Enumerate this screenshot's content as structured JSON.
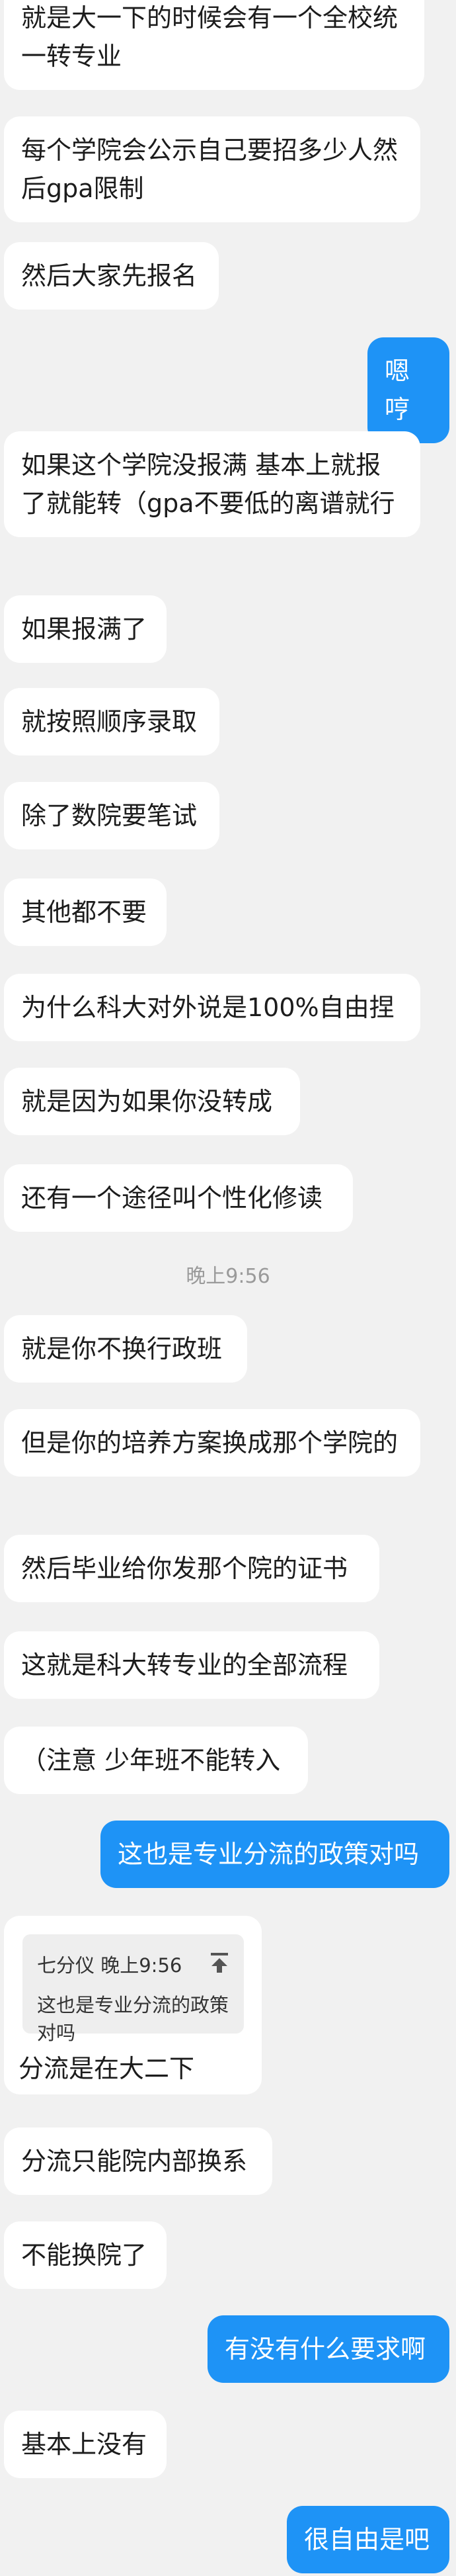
{
  "messages": [
    {
      "text": "就是大一下的时候会有一个全校统一转专业"
    },
    {
      "text": "每个学院会公示自己要招多少人然后gpa限制"
    },
    {
      "text": "然后大家先报名"
    },
    {
      "text": "嗯哼"
    },
    {
      "text": "如果这个学院没报满 基本上就报了就能转（gpa不要低的离谱就行"
    },
    {
      "text": "如果报满了"
    },
    {
      "text": "就按照顺序录取"
    },
    {
      "text": "除了数院要笔试"
    },
    {
      "text": "其他都不要"
    },
    {
      "text": "为什么科大对外说是100%自由捏"
    },
    {
      "text": "就是因为如果你没转成"
    },
    {
      "text": "还有一个途径叫个性化修读"
    },
    {
      "text": "就是你不换行政班"
    },
    {
      "text": "但是你的培养方案换成那个学院的"
    },
    {
      "text": "然后毕业给你发那个院的证书"
    },
    {
      "text": "这就是科大转专业的全部流程"
    },
    {
      "text": "（注意 少年班不能转入"
    },
    {
      "text": "这也是专业分流的政策对吗"
    },
    {
      "text": "分流只能院内部换系"
    },
    {
      "text": "不能换院了"
    },
    {
      "text": "有没有什么要求啊"
    },
    {
      "text": "基本上没有"
    },
    {
      "text": "很自由是吧"
    }
  ],
  "timestamp": "晚上9:56",
  "quote_reply": {
    "meta": "七分仪 晚上9:56",
    "quoted_text": "这也是专业分流的政策对吗",
    "reply_text": "分流是在大二下"
  },
  "colors": {
    "background": "#f1f1f1",
    "incoming_bubble": "#ffffff",
    "outgoing_bubble": "#1e93f6"
  }
}
